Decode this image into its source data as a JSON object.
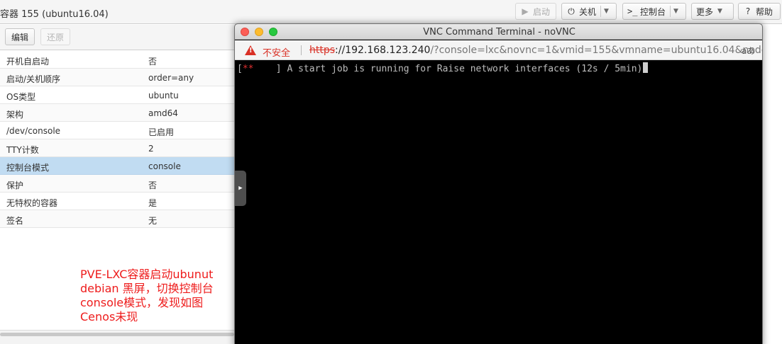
{
  "header": {
    "title": "容器 155 (ubuntu16.04)",
    "buttons": {
      "start": {
        "label": "启动",
        "icon": "play-icon"
      },
      "shutdown": {
        "label": "关机",
        "icon": "power-icon"
      },
      "console": {
        "label": "控制台",
        "icon": "terminal-icon"
      },
      "more": {
        "label": "更多"
      },
      "help": {
        "label": "帮助",
        "icon": "help-icon"
      }
    }
  },
  "toolbar": {
    "edit_label": "编辑",
    "revert_label": "还原"
  },
  "options": [
    {
      "key": "开机自启动",
      "value": "否"
    },
    {
      "key": "启动/关机顺序",
      "value": "order=any"
    },
    {
      "key": "OS类型",
      "value": "ubuntu"
    },
    {
      "key": "架构",
      "value": "amd64"
    },
    {
      "key": "/dev/console",
      "value": "已启用"
    },
    {
      "key": "TTY计数",
      "value": "2"
    },
    {
      "key": "控制台模式",
      "value": "console",
      "selected": true
    },
    {
      "key": "保护",
      "value": "否"
    },
    {
      "key": "无特权的容器",
      "value": "是"
    },
    {
      "key": "签名",
      "value": "无"
    }
  ],
  "annotation": {
    "lines": [
      "PVE-LXC容器启动ubunut",
      "debian 黑屏，切换控制台",
      "console模式，发现如图",
      "Cenos未现"
    ],
    "color": "#ee1c1c"
  },
  "vnc": {
    "window_title": "VNC Command Terminal - noVNC",
    "security_label": "不安全",
    "url_scheme": "https",
    "url_host": "://192.168.123.240",
    "url_rest": "/?console=lxc&novnc=1&vmid=155&vmname=ubuntu16.04&node...",
    "translate_glyph": "aあ",
    "terminal": {
      "open_bracket": "[",
      "stars": "**",
      "text": "    ] A start job is running for Raise network interfaces (12s / 5min)"
    }
  },
  "colors": {
    "selected_row": "#c1dcf2",
    "warning_red": "#d93025",
    "terminal_bg": "#000000"
  }
}
